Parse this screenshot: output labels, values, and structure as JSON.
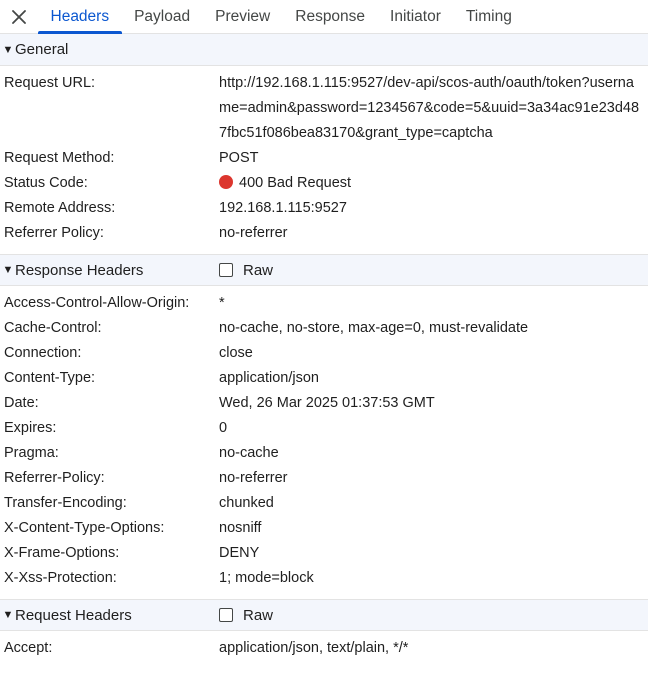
{
  "tabs": [
    "Headers",
    "Payload",
    "Preview",
    "Response",
    "Initiator",
    "Timing"
  ],
  "active_tab": "Headers",
  "general": {
    "title": "General",
    "rows": [
      {
        "key": "Request URL:",
        "value": "http://192.168.1.115:9527/dev-api/scos-auth/oauth/token?username=admin&password=1234567&code=5&uuid=3a34ac91e23d487fbc51f086bea83170&grant_type=captcha"
      },
      {
        "key": "Request Method:",
        "value": "POST"
      },
      {
        "key": "Status Code:",
        "value": "400 Bad Request"
      },
      {
        "key": "Remote Address:",
        "value": "192.168.1.115:9527"
      },
      {
        "key": "Referrer Policy:",
        "value": "no-referrer"
      }
    ],
    "status_color": "#dc362e"
  },
  "response_headers": {
    "title": "Response Headers",
    "raw_label": "Raw",
    "rows": [
      {
        "key": "Access-Control-Allow-Origin:",
        "value": "*"
      },
      {
        "key": "Cache-Control:",
        "value": "no-cache, no-store, max-age=0, must-revalidate"
      },
      {
        "key": "Connection:",
        "value": "close"
      },
      {
        "key": "Content-Type:",
        "value": "application/json"
      },
      {
        "key": "Date:",
        "value": "Wed, 26 Mar 2025 01:37:53 GMT"
      },
      {
        "key": "Expires:",
        "value": "0"
      },
      {
        "key": "Pragma:",
        "value": "no-cache"
      },
      {
        "key": "Referrer-Policy:",
        "value": "no-referrer"
      },
      {
        "key": "Transfer-Encoding:",
        "value": "chunked"
      },
      {
        "key": "X-Content-Type-Options:",
        "value": "nosniff"
      },
      {
        "key": "X-Frame-Options:",
        "value": "DENY"
      },
      {
        "key": "X-Xss-Protection:",
        "value": "1; mode=block"
      }
    ]
  },
  "request_headers": {
    "title": "Request Headers",
    "raw_label": "Raw",
    "rows": [
      {
        "key": "Accept:",
        "value": "application/json, text/plain, */*"
      }
    ]
  },
  "colors": {
    "accent": "#0b57d0",
    "section_bg": "#f3f6fc"
  },
  "icons": {
    "close": "close-icon",
    "collapse": "triangle-down-icon"
  }
}
